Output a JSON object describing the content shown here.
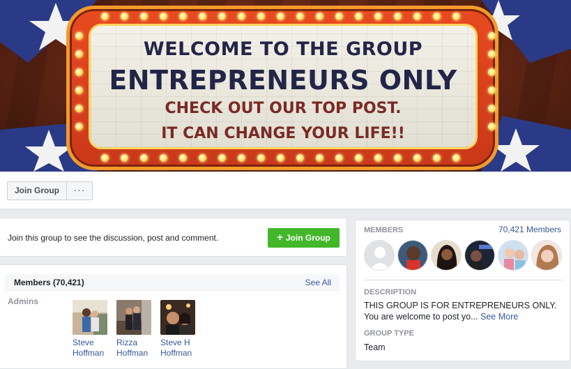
{
  "cover": {
    "line1": "WELCOME TO THE GROUP",
    "line2": "ENTREPRENEURS ONLY",
    "line3": "CHECK OUT OUR TOP POST.",
    "line4": "IT CAN CHANGE YOUR LIFE!!"
  },
  "action_bar": {
    "join_label": "Join Group",
    "more_label": "···"
  },
  "join_prompt": {
    "message": "Join this group to see the discussion, post and comment.",
    "button_label": "Join Group",
    "button_icon": "plus-icon",
    "button_color": "#42b72a"
  },
  "members_section": {
    "title": "Members (70,421)",
    "see_all": "See All",
    "admins_label": "Admins",
    "admins": [
      {
        "first": "Steve",
        "last": "Hoffman"
      },
      {
        "first": "Rizza",
        "last": "Hoffman"
      },
      {
        "first": "Steve H",
        "last": "Hoffman"
      }
    ]
  },
  "sidebar": {
    "members_label": "MEMBERS",
    "members_count": "70,421 Members",
    "description_label": "DESCRIPTION",
    "description_text": "THIS GROUP IS FOR ENTREPRENEURS ONLY. You are welcome to post yo...",
    "see_more": "See More",
    "group_type_label": "GROUP TYPE",
    "group_type": "Team"
  },
  "colors": {
    "link": "#365899",
    "green": "#42b72a",
    "background": "#e9ebee"
  }
}
